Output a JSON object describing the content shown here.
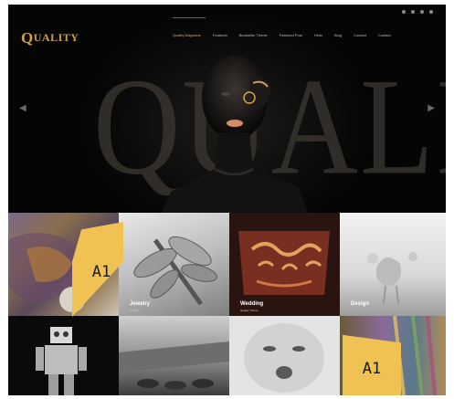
{
  "site": {
    "logo": "UALITY",
    "logo_initial": "Q",
    "nav": [
      "Quality Magazine",
      "Features",
      "Bestseller Theme",
      "Featured Post",
      "Hello",
      "Blog",
      "Contact",
      "Contact"
    ],
    "hero_word": "QUALITY"
  },
  "tiles": [
    {
      "title": "",
      "subtitle": ""
    },
    {
      "title": "Jewelry",
      "subtitle": "Quality"
    },
    {
      "title": "Wedding",
      "subtitle": "Quality Theme"
    },
    {
      "title": "Design",
      "subtitle": ""
    },
    {
      "title": "",
      "subtitle": ""
    },
    {
      "title": "",
      "subtitle": ""
    },
    {
      "title": "",
      "subtitle": ""
    },
    {
      "title": "",
      "subtitle": ""
    }
  ],
  "stamps": [
    "A1",
    "A1"
  ],
  "colors": {
    "accent_gold": "#f0c254",
    "logo_gold": "#c9a24a",
    "background": "#000000"
  }
}
